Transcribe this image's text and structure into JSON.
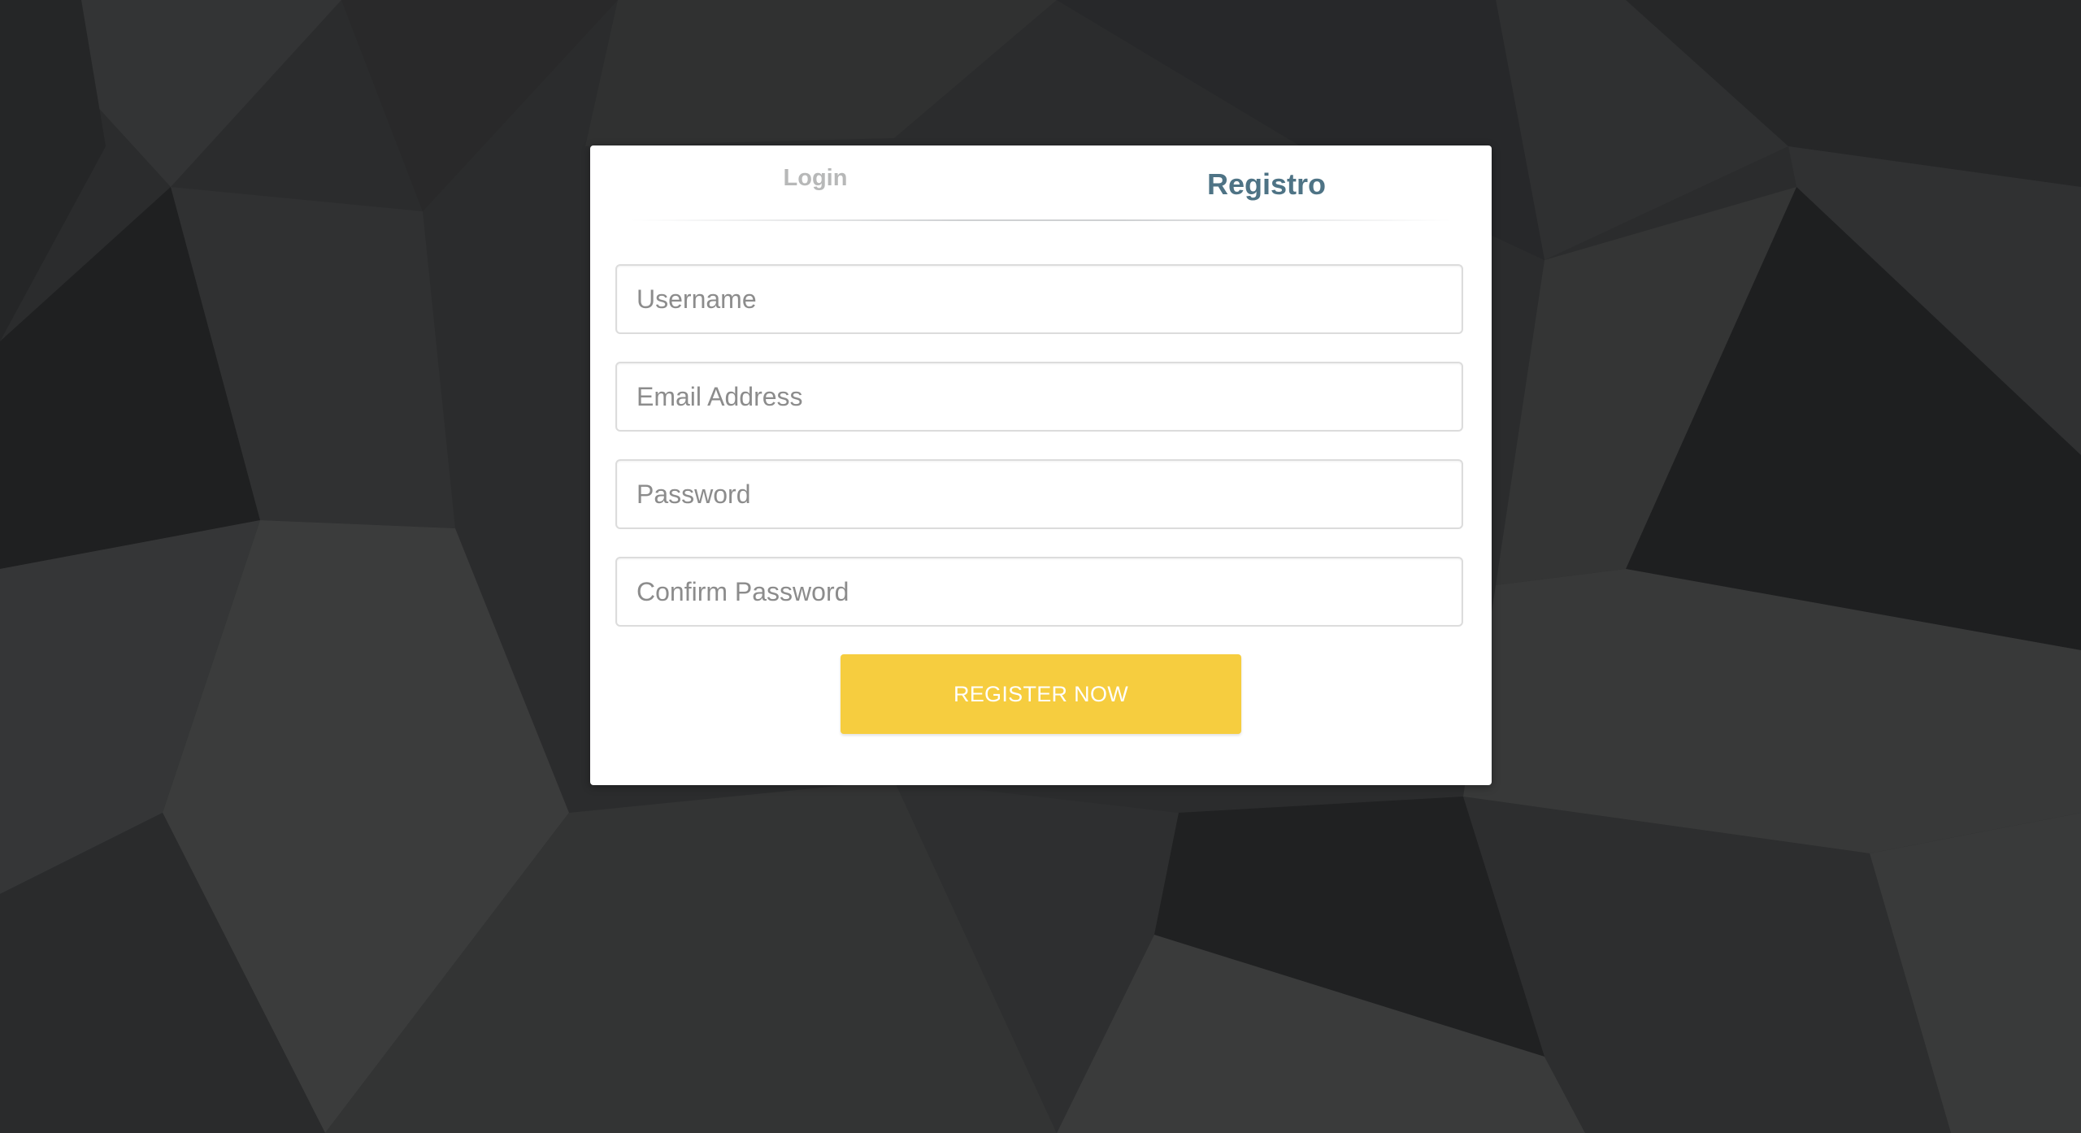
{
  "tabs": {
    "login_label": "Login",
    "register_label": "Registro"
  },
  "form": {
    "username_placeholder": "Username",
    "email_placeholder": "Email Address",
    "password_placeholder": "Password",
    "confirm_password_placeholder": "Confirm Password",
    "submit_label": "REGISTER NOW"
  },
  "colors": {
    "accent_button": "#f6cd3f",
    "active_tab": "#4e7385",
    "inactive_tab": "#b7b8b8",
    "background": "#2b2c2d"
  }
}
